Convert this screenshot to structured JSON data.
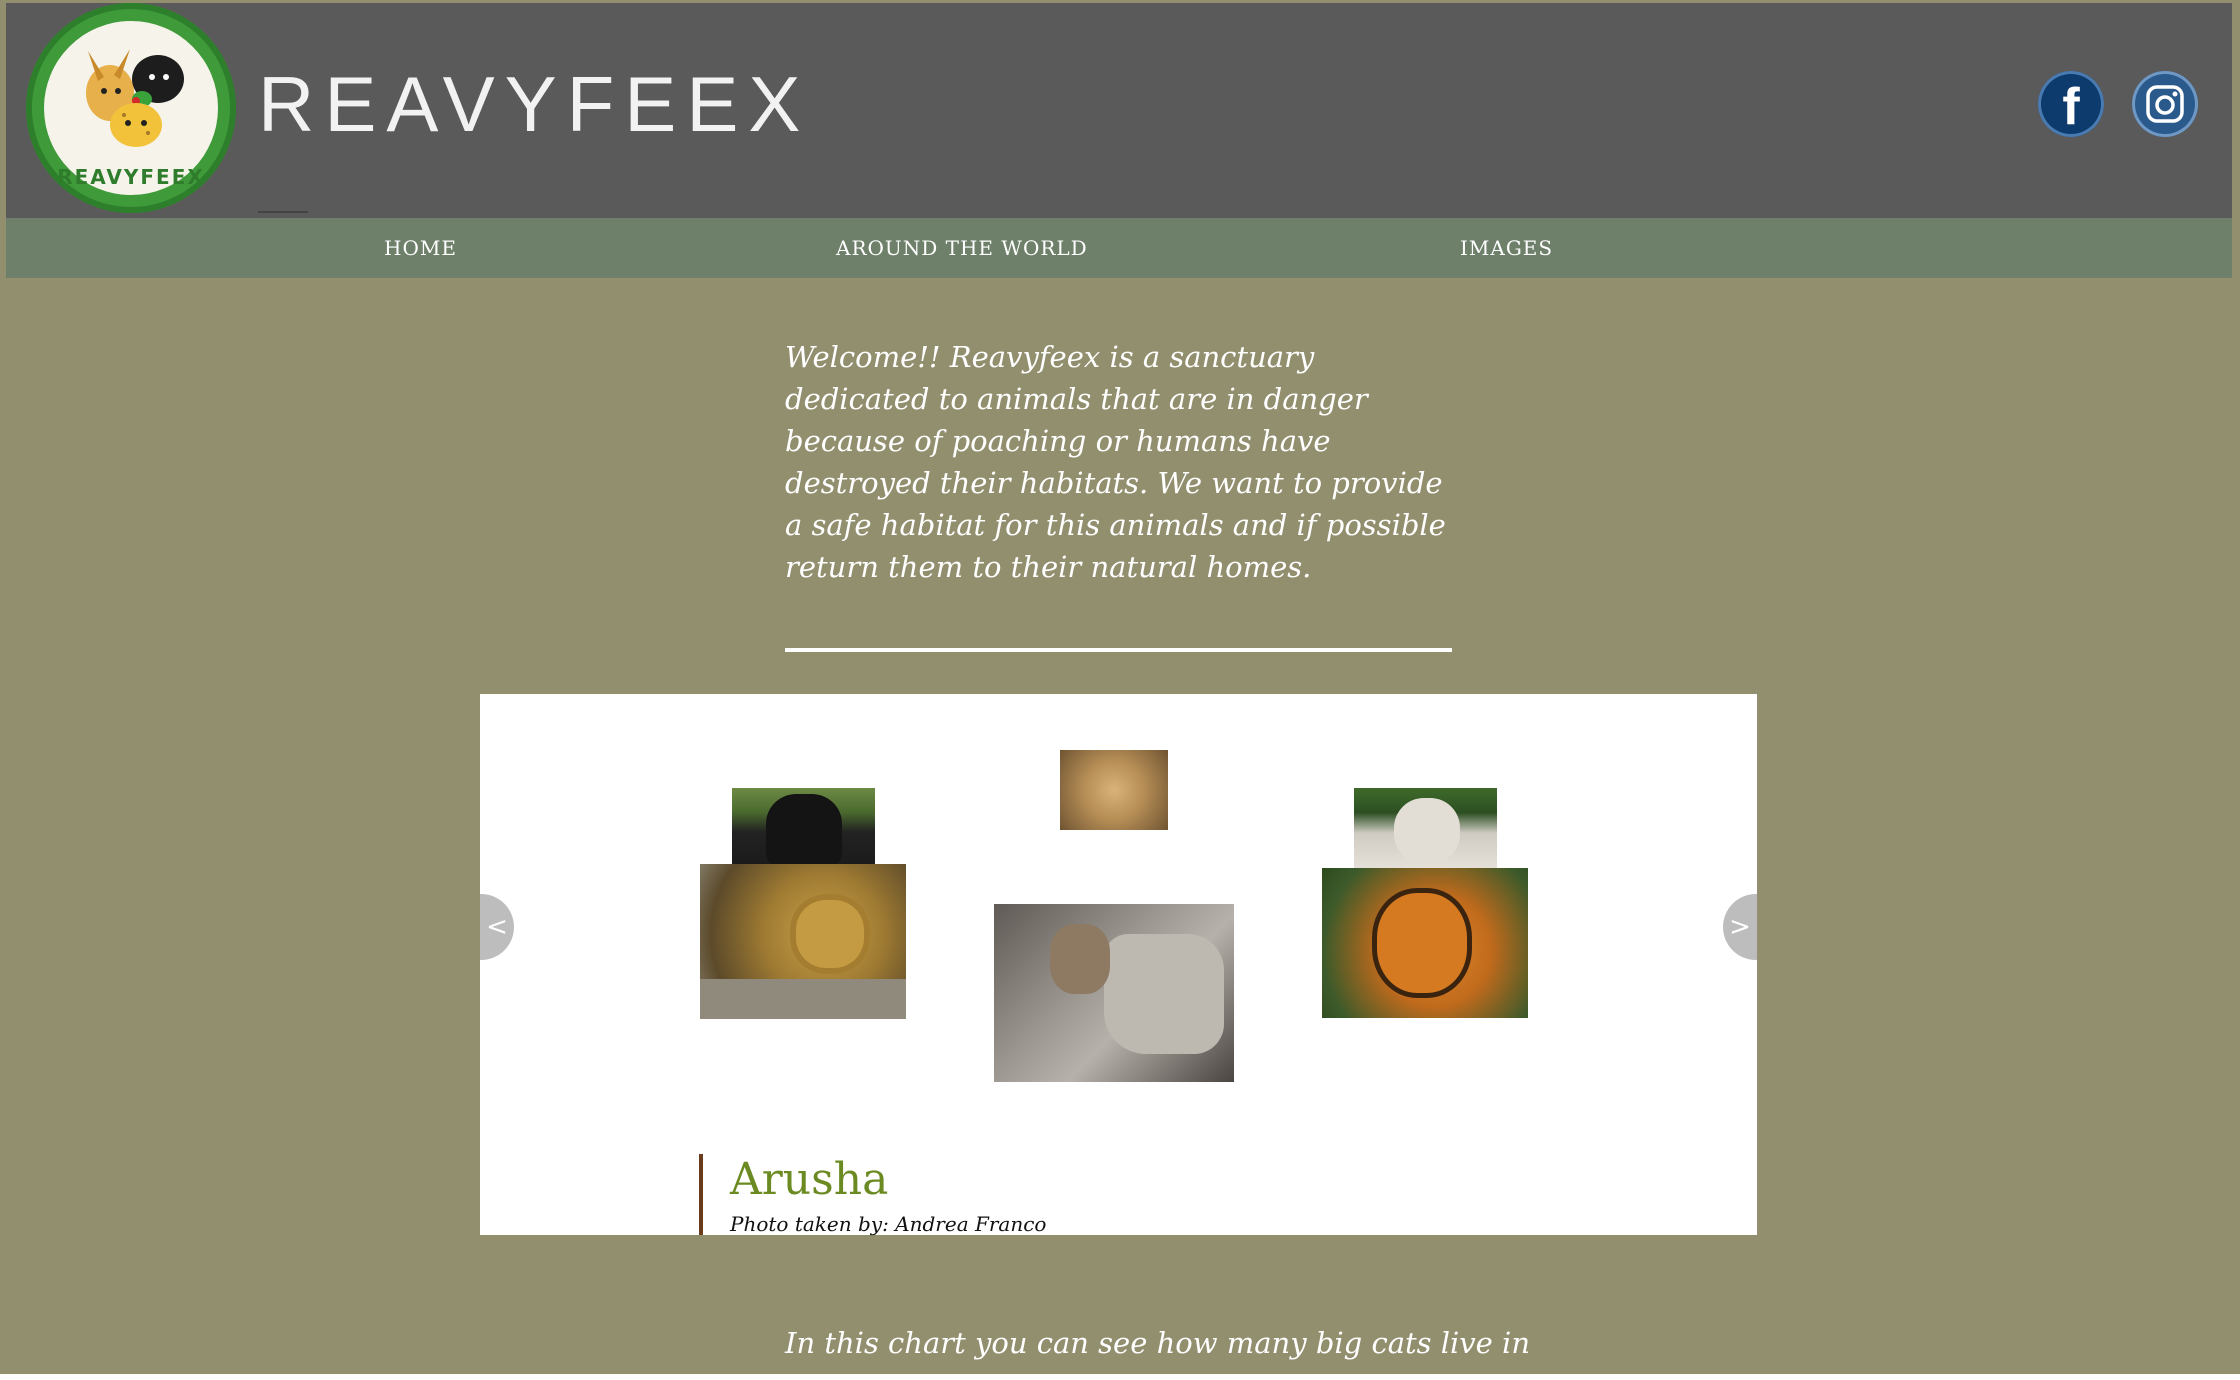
{
  "brand": {
    "name": "REAVYFEEX",
    "logo_text": "REAVYFEEX"
  },
  "social": [
    {
      "name": "facebook-icon",
      "glyph": "f"
    },
    {
      "name": "instagram-icon"
    }
  ],
  "nav": {
    "items": [
      {
        "label": "HOME"
      },
      {
        "label": "AROUND THE WORLD"
      },
      {
        "label": "IMAGES"
      }
    ]
  },
  "intro": {
    "text": "Welcome!! Reavyfeex is a sanctuary dedicated to animals that are in danger because of poaching or humans have destroyed their habitats. We want to provide a safe habitat for this animals and if possible return them to their natural homes."
  },
  "gallery": {
    "prev_label": "<",
    "next_label": ">",
    "photos": [
      {
        "name": "black-jaguar-photo",
        "colors": [
          "#5c7a3a",
          "#1e1e1e"
        ]
      },
      {
        "name": "jaguar-photo",
        "colors": [
          "#b7903d",
          "#4d3a1d"
        ]
      },
      {
        "name": "cheetah-photo",
        "colors": [
          "#c8a26a",
          "#6a4f2b"
        ]
      },
      {
        "name": "bobcat-photo",
        "colors": [
          "#8e8a85",
          "#3e3a36"
        ]
      },
      {
        "name": "white-tiger-photo",
        "colors": [
          "#d9d6cf",
          "#2c4f22"
        ]
      },
      {
        "name": "tiger-photo",
        "colors": [
          "#d07a22",
          "#2c3d1c"
        ]
      }
    ],
    "caption": {
      "title": "Arusha",
      "credit": "Photo taken by: Andrea Franco"
    }
  },
  "chart_intro": {
    "text": "In this chart you can see how many big cats live in"
  },
  "colors": {
    "page_bg": "#928f6e",
    "header_bg": "#5a5a5a",
    "nav_bg": "#6e806a",
    "caption_title": "#6b8b22",
    "caption_bar": "#6b3b1e"
  }
}
